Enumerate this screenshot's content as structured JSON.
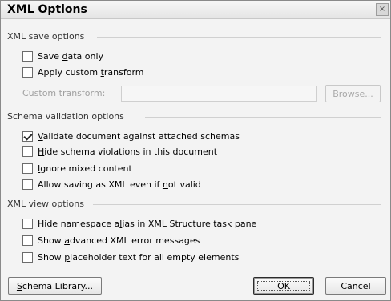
{
  "window": {
    "title": "XML Options",
    "close_glyph": "×"
  },
  "save_section": {
    "header": "XML save options",
    "save_data_only": {
      "pre": "Save ",
      "acc": "d",
      "post": "ata only",
      "checked": false
    },
    "apply_custom_transform": {
      "pre": "Apply custom ",
      "acc": "t",
      "post": "ransform",
      "checked": false
    },
    "custom_transform_label": "Custom transform:",
    "custom_transform_value": "",
    "browse_label": "Browse..."
  },
  "schema_section": {
    "header": "Schema validation options",
    "validate": {
      "pre": "",
      "acc": "V",
      "post": "alidate document against attached schemas",
      "checked": true
    },
    "hide_violations": {
      "pre": "",
      "acc": "H",
      "post": "ide schema violations in this document",
      "checked": false
    },
    "ignore_mixed": {
      "pre": "",
      "acc": "I",
      "post": "gnore mixed content",
      "checked": false
    },
    "allow_saving": {
      "pre": "Allow saving as XML even if ",
      "acc": "n",
      "post": "ot valid",
      "checked": false
    }
  },
  "view_section": {
    "header": "XML view options",
    "hide_namespace": {
      "pre": "Hide namespace a",
      "acc": "l",
      "post": "ias in XML Structure task pane",
      "checked": false
    },
    "show_advanced": {
      "pre": "Show ",
      "acc": "a",
      "post": "dvanced XML error messages",
      "checked": false
    },
    "show_placeholder": {
      "pre": "Show ",
      "acc": "p",
      "post": "laceholder text for all empty elements",
      "checked": false
    }
  },
  "footer": {
    "schema_library": {
      "acc": "S",
      "post": "chema Library..."
    },
    "ok_label": "OK",
    "cancel_label": "Cancel"
  }
}
